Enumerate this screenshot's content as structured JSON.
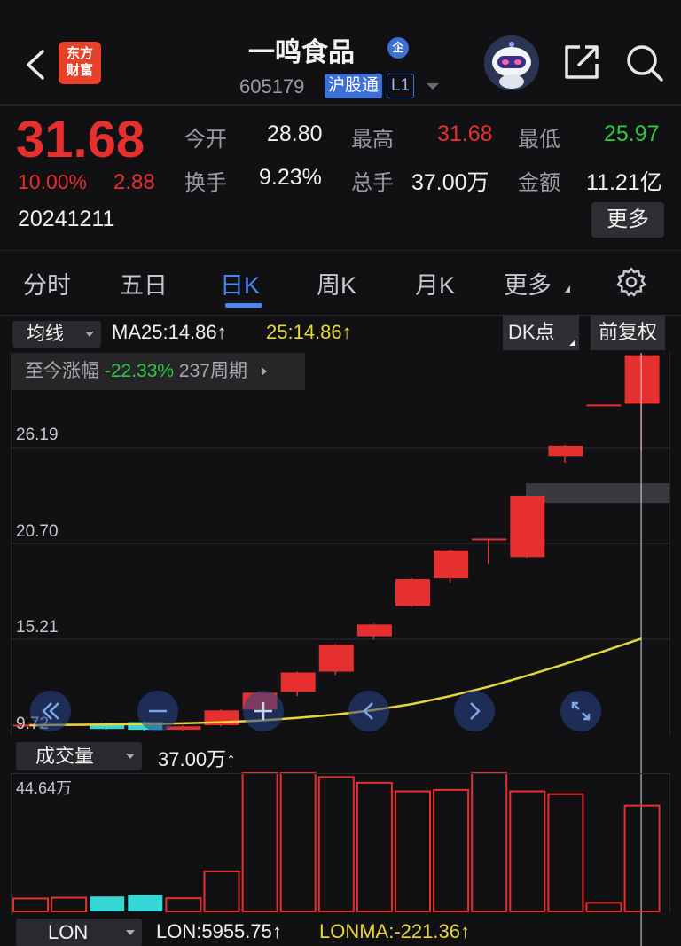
{
  "header": {
    "logo_line1": "东方",
    "logo_line2": "财富",
    "stock_name": "一鸣食品",
    "enterprise_badge": "企",
    "stock_code": "605179",
    "connect_tag": "沪股通",
    "level_tag": "L1"
  },
  "quote": {
    "price": "31.68",
    "change_pct": "10.00%",
    "change_abs": "2.88",
    "date": "20241211",
    "fields": [
      {
        "label": "今开",
        "value": "28.80",
        "color": "neutral"
      },
      {
        "label": "最高",
        "value": "31.68",
        "color": "red"
      },
      {
        "label": "最低",
        "value": "25.97",
        "color": "green"
      },
      {
        "label": "换手",
        "value": "9.23%",
        "color": "neutral"
      },
      {
        "label": "总手",
        "value": "37.00万",
        "color": "neutral"
      },
      {
        "label": "金额",
        "value": "11.21亿",
        "color": "neutral"
      }
    ],
    "more_label": "更多"
  },
  "tabs": [
    {
      "label": "分时",
      "active": false
    },
    {
      "label": "五日",
      "active": false
    },
    {
      "label": "日K",
      "active": true
    },
    {
      "label": "周K",
      "active": false
    },
    {
      "label": "月K",
      "active": false
    },
    {
      "label": "更多",
      "active": false
    }
  ],
  "indicator_bar": {
    "ma_select": "均线",
    "ma_text": "MA25:14.86↑",
    "ma_text2": "25:14.86↑",
    "dk_label": "DK点",
    "fuquan_label": "前复权"
  },
  "range_box": {
    "prefix": "至今涨幅",
    "pct": "-22.33%",
    "suffix": "237周期"
  },
  "volume": {
    "select": "成交量",
    "text": "37.00万↑",
    "max_label": "44.64万"
  },
  "lon": {
    "select": "LON",
    "text": "LON:5955.75↑",
    "lonma": "LONMA:-221.36↑"
  },
  "colors": {
    "up": "#e62f2f",
    "down": "#2fc545",
    "accent": "#4a86f0",
    "ma": "#e8d53a",
    "down_bar": "#36d6d6"
  },
  "chart_data": {
    "type": "candlestick",
    "y_ticks": [
      "26.19",
      "20.70",
      "15.21",
      "9.72"
    ],
    "ylim": [
      9.72,
      31.68
    ],
    "candles": [
      {
        "o": 9.75,
        "c": 9.75,
        "h": 9.8,
        "l": 9.7
      },
      {
        "o": 9.78,
        "c": 9.78,
        "h": 9.82,
        "l": 9.74
      },
      {
        "o": 9.8,
        "c": 9.5,
        "h": 9.85,
        "l": 9.45
      },
      {
        "o": 9.9,
        "c": 9.45,
        "h": 9.95,
        "l": 9.4
      },
      {
        "o": 9.45,
        "c": 9.65,
        "h": 9.7,
        "l": 9.4
      },
      {
        "o": 9.72,
        "c": 10.6,
        "h": 10.65,
        "l": 9.65
      },
      {
        "o": 10.65,
        "c": 11.65,
        "h": 11.7,
        "l": 10.6
      },
      {
        "o": 11.7,
        "c": 12.85,
        "h": 12.9,
        "l": 11.45
      },
      {
        "o": 12.9,
        "c": 14.5,
        "h": 14.55,
        "l": 12.7
      },
      {
        "o": 15.0,
        "c": 15.7,
        "h": 15.75,
        "l": 14.8
      },
      {
        "o": 16.8,
        "c": 18.4,
        "h": 18.45,
        "l": 16.75
      },
      {
        "o": 18.45,
        "c": 20.1,
        "h": 20.15,
        "l": 18.15
      },
      {
        "o": 20.8,
        "c": 20.8,
        "h": 20.8,
        "l": 19.3
      },
      {
        "o": 19.7,
        "c": 23.3,
        "h": 23.35,
        "l": 19.65
      },
      {
        "o": 25.7,
        "c": 26.3,
        "h": 26.35,
        "l": 25.3
      },
      {
        "o": 28.75,
        "c": 28.75,
        "h": 28.75,
        "l": 28.75
      },
      {
        "o": 28.8,
        "c": 31.68,
        "h": 31.68,
        "l": 25.97
      }
    ],
    "ma25": [
      9.72,
      9.74,
      9.76,
      9.79,
      9.83,
      9.9,
      10.0,
      10.15,
      10.35,
      10.62,
      10.98,
      11.45,
      12.0,
      12.65,
      13.35,
      14.1,
      14.86
    ],
    "volume": [
      4.5,
      4.8,
      5.2,
      5.8,
      4.6,
      14.0,
      49.0,
      50.0,
      47.0,
      45.0,
      42.0,
      42.5,
      52.0,
      42.0,
      41.0,
      3.0,
      37.0
    ],
    "volume_dir": [
      "up",
      "up",
      "down",
      "down",
      "up",
      "up",
      "up",
      "up",
      "up",
      "up",
      "up",
      "up",
      "up",
      "up",
      "up",
      "up",
      "up"
    ],
    "volume_max": 44.64,
    "support_band_price": 23.5
  }
}
